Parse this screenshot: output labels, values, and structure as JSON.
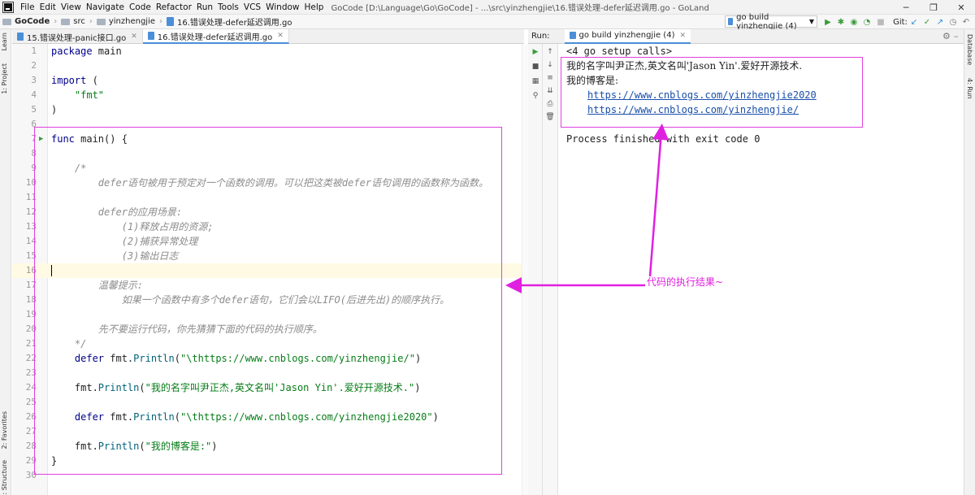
{
  "menubar": {
    "items": [
      "File",
      "Edit",
      "View",
      "Navigate",
      "Code",
      "Refactor",
      "Run",
      "Tools",
      "VCS",
      "Window",
      "Help"
    ],
    "title": "GoCode [D:\\Language\\Go\\GoCode] - ...\\src\\yinzhengjie\\16.错误处理-defer延迟调用.go - GoLand"
  },
  "navbar": {
    "crumbs": [
      "GoCode",
      "src",
      "yinzhengjie",
      "16.错误处理-defer延迟调用.go"
    ],
    "run_config": "go build yinzhengjie (4)",
    "git_label": "Git:"
  },
  "left_stripe": {
    "project": "1: Project",
    "learn": "Learn",
    "favorites": "2: Favorites",
    "structure": "Z: Structure"
  },
  "right_stripe": {
    "database": "Database",
    "run": "4: Run"
  },
  "editor_tabs": [
    {
      "label": "15.错误处理-panic接口.go",
      "active": false
    },
    {
      "label": "16.错误处理-defer延迟调用.go",
      "active": true
    }
  ],
  "code": [
    {
      "n": "1",
      "t": "package main",
      "k": "pkg"
    },
    {
      "n": "2",
      "t": "",
      "k": "plain"
    },
    {
      "n": "3",
      "t": "import (",
      "k": "imp"
    },
    {
      "n": "4",
      "t": "    \"fmt\"",
      "k": "str"
    },
    {
      "n": "5",
      "t": ")",
      "k": "plain"
    },
    {
      "n": "6",
      "t": "",
      "k": "plain"
    },
    {
      "n": "7",
      "t": "func main() {",
      "k": "func"
    },
    {
      "n": "8",
      "t": "",
      "k": "plain"
    },
    {
      "n": "9",
      "t": "    /*",
      "k": "cm"
    },
    {
      "n": "10",
      "t": "        defer语句被用于预定对一个函数的调用。可以把这类被defer语句调用的函数称为函数。",
      "k": "cm"
    },
    {
      "n": "11",
      "t": "",
      "k": "plain"
    },
    {
      "n": "12",
      "t": "        defer的应用场景:",
      "k": "cm"
    },
    {
      "n": "13",
      "t": "            (1)释放占用的资源;",
      "k": "cm"
    },
    {
      "n": "14",
      "t": "            (2)捕获异常处理",
      "k": "cm"
    },
    {
      "n": "15",
      "t": "            (3)输出日志",
      "k": "cm"
    },
    {
      "n": "16",
      "t": "",
      "k": "cur"
    },
    {
      "n": "17",
      "t": "        温馨提示:",
      "k": "cm"
    },
    {
      "n": "18",
      "t": "            如果一个函数中有多个defer语句，它们会以LIFO(后进先出)的顺序执行。",
      "k": "cm"
    },
    {
      "n": "19",
      "t": "",
      "k": "plain"
    },
    {
      "n": "20",
      "t": "        先不要运行代码，你先猜猜下面的代码的执行顺序。",
      "k": "cm"
    },
    {
      "n": "21",
      "t": "    */",
      "k": "cm"
    },
    {
      "n": "22",
      "t": "    defer fmt.Println(\"\\thttps://www.cnblogs.com/yinzhengjie/\")",
      "k": "defer"
    },
    {
      "n": "23",
      "t": "",
      "k": "plain"
    },
    {
      "n": "24",
      "t": "    fmt.Println(\"我的名字叫尹正杰,英文名叫'Jason Yin'.爱好开源技术.\")",
      "k": "call"
    },
    {
      "n": "25",
      "t": "",
      "k": "plain"
    },
    {
      "n": "26",
      "t": "    defer fmt.Println(\"\\thttps://www.cnblogs.com/yinzhengjie2020\")",
      "k": "defer"
    },
    {
      "n": "27",
      "t": "",
      "k": "plain"
    },
    {
      "n": "28",
      "t": "    fmt.Println(\"我的博客是:\")",
      "k": "call"
    },
    {
      "n": "29",
      "t": "}",
      "k": "plain"
    },
    {
      "n": "30",
      "t": "",
      "k": "plain"
    }
  ],
  "run_panel": {
    "label": "Run:",
    "tab": "go build yinzhengjie (4)",
    "output": {
      "setup": "<4 go setup calls>",
      "line1": "我的名字叫尹正杰,英文名叫'Jason Yin'.爱好开源技术.",
      "line2": "我的博客是:",
      "link1": "https://www.cnblogs.com/yinzhengjie2020",
      "link2": "https://www.cnblogs.com/yinzhengjie/",
      "exit": "Process finished with exit code 0"
    }
  },
  "annotation": {
    "text": "代码的执行结果~",
    "color": "#e020e0"
  },
  "colors": {
    "keyword": "#00008b",
    "string": "#067d17",
    "comment": "#8c8c8c",
    "link": "#1a4faa",
    "highlight": "#e040e0"
  }
}
